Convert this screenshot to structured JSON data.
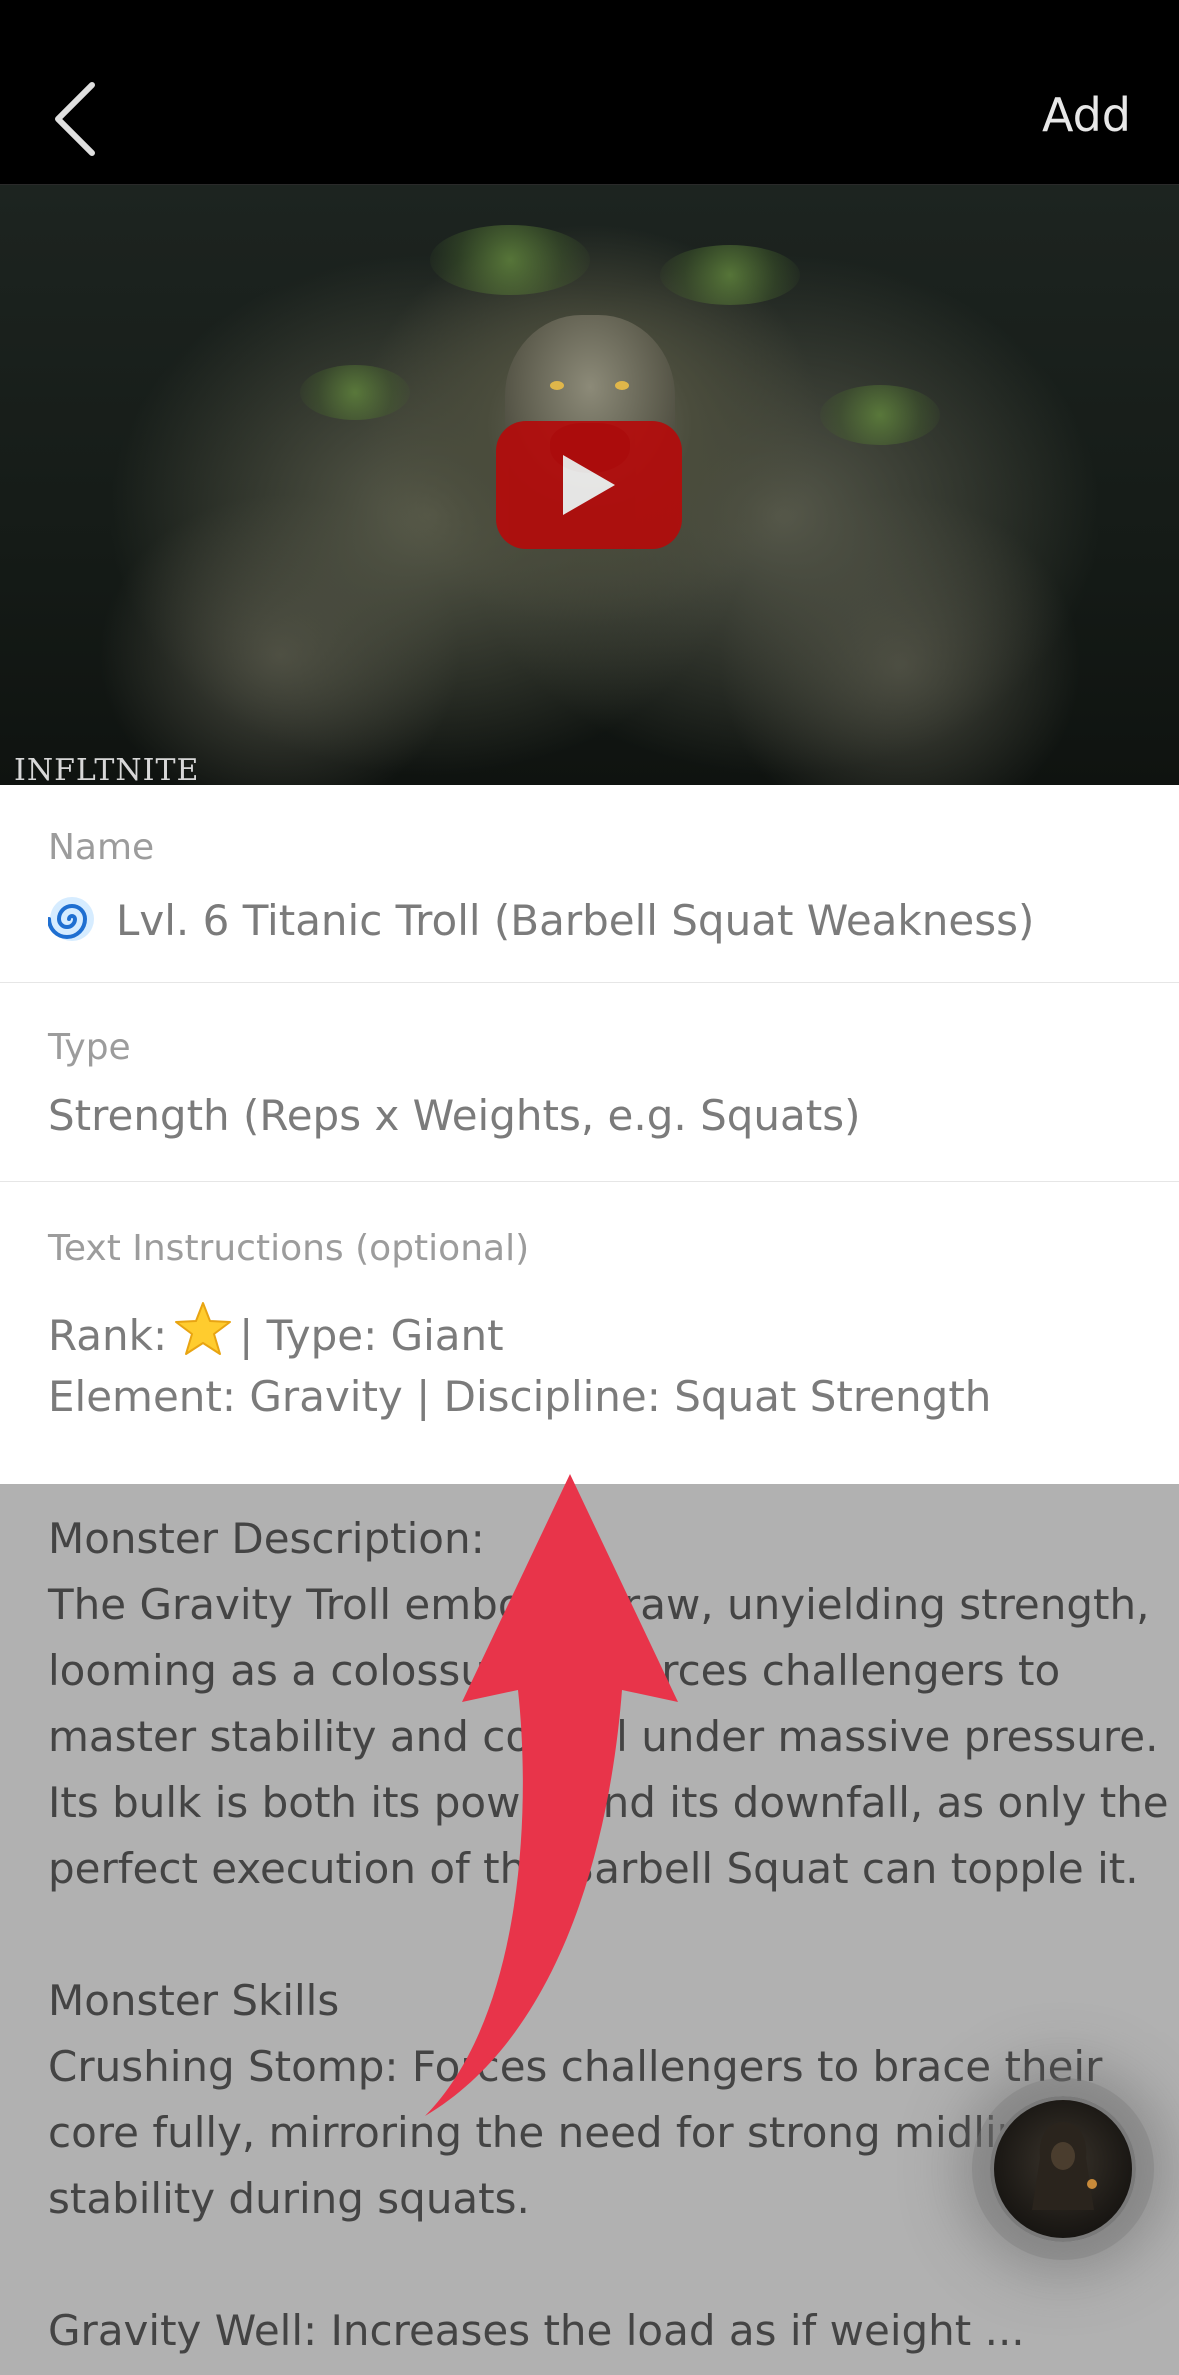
{
  "header": {
    "add_label": "Add"
  },
  "hero": {
    "watermark": "INFLTNITE"
  },
  "name_field": {
    "label": "Name",
    "value": "Lvl. 6 Titanic Troll (Barbell Squat Weakness)"
  },
  "type_field": {
    "label": "Type",
    "value": "Strength (Reps x Weights, e.g. Squats)"
  },
  "instructions_field": {
    "label": "Text Instructions (optional)",
    "rank_prefix": "Rank:",
    "rank_suffix": "| Type: Giant",
    "line2": "Element: Gravity | Discipline: Squat Strength"
  },
  "description": {
    "lines": [
      "Monster Description:",
      "The Gravity Troll embodies raw, unyielding strength,",
      "looming as a colossus that forces challengers to",
      "master stability and control under massive pressure.",
      "Its bulk is both its power and its downfall, as only the",
      "perfect execution of the Barbell Squat can topple it.",
      "",
      "Monster Skills",
      "Crushing Stomp: Forces challengers to brace their",
      "core fully, mirroring the need for strong midline",
      "stability during squats.",
      "",
      "Gravity Well: Increases the load as if weight ..."
    ]
  },
  "colors": {
    "arrow": "#e8344a",
    "play": "#b40b0b"
  }
}
